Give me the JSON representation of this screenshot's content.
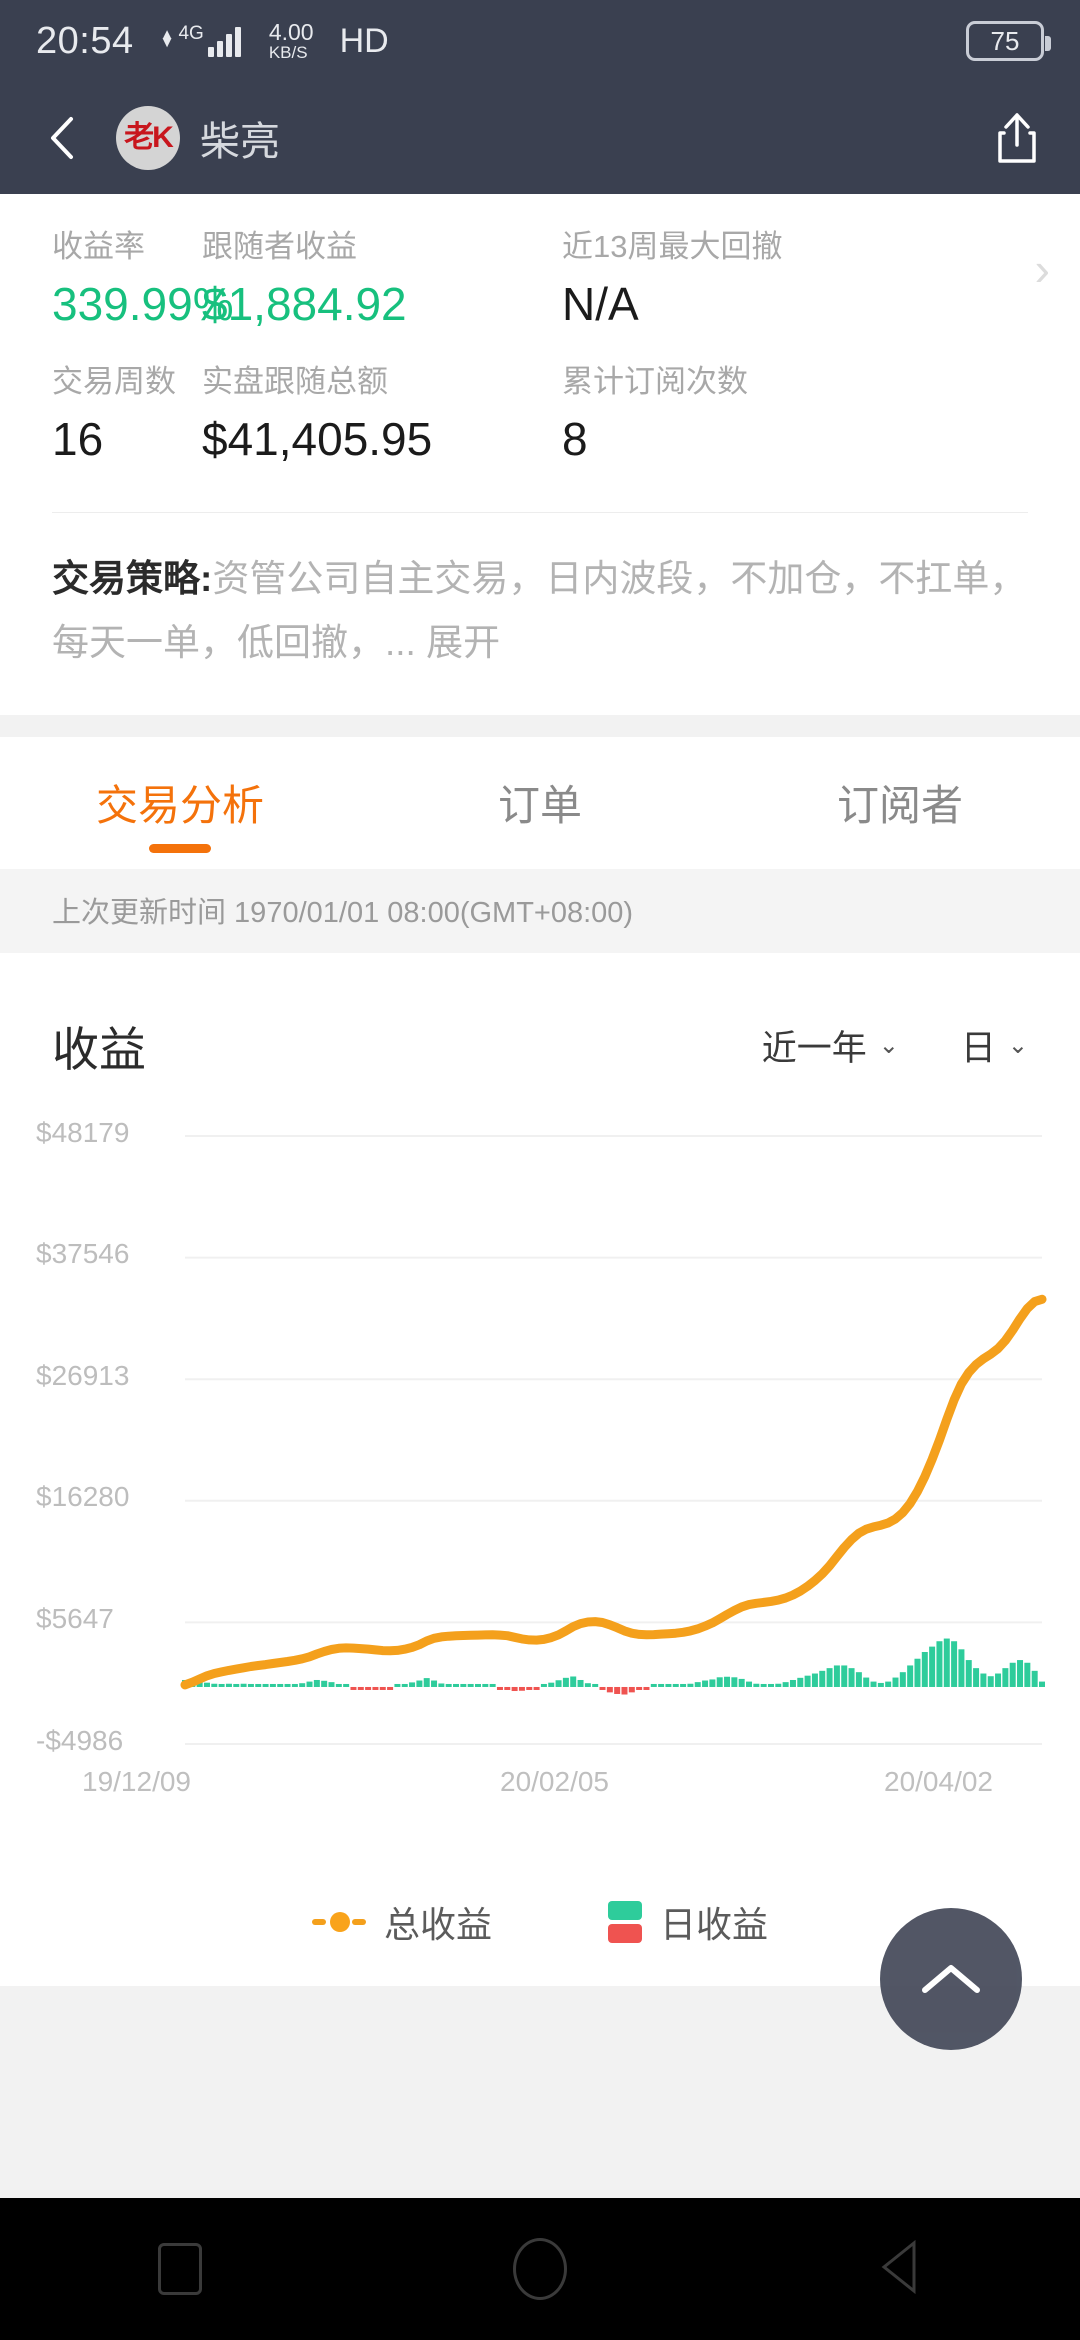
{
  "status_bar": {
    "time": "20:54",
    "network_type": "4G",
    "speed_value": "4.00",
    "speed_unit": "KB/S",
    "hd_label": "HD",
    "battery_level": "75"
  },
  "app_bar": {
    "back_icon": "chevron-left-icon",
    "avatar_text": "老K",
    "account_name": "柴亮",
    "share_icon": "share-icon"
  },
  "stats": {
    "chevron": "›",
    "row1": [
      {
        "label": "收益率",
        "value": "339.99%",
        "color": "green"
      },
      {
        "label": "跟随者收益",
        "value": "$1,884.92",
        "color": "green"
      },
      {
        "label": "近13周最大回撤",
        "value": "N/A",
        "color": "dark"
      }
    ],
    "row2": [
      {
        "label": "交易周数",
        "value": "16",
        "color": "dark"
      },
      {
        "label": "实盘跟随总额",
        "value": "$41,405.95",
        "color": "dark"
      },
      {
        "label": "累计订阅次数",
        "value": "8",
        "color": "dark"
      }
    ]
  },
  "strategy": {
    "title": "交易策略:",
    "body": "资管公司自主交易，日内波段，不加仓，不扛单，每天一单，低回撤，...",
    "expand": "展开"
  },
  "tabs": [
    {
      "label": "交易分析",
      "active": true
    },
    {
      "label": "订单",
      "active": false
    },
    {
      "label": "订阅者",
      "active": false
    }
  ],
  "updated": "上次更新时间 1970/01/01 08:00(GMT+08:00)",
  "chart_header": {
    "title": "收益",
    "range_select": "近一年",
    "period_select": "日",
    "caret": "⌄"
  },
  "legend": [
    {
      "label": "总收益",
      "marker": "line-dot",
      "color": "#f4a01c"
    },
    {
      "label": "日收益",
      "marker": "bars",
      "up_color": "#2ecc9b",
      "down_color": "#ef5350"
    }
  ],
  "fab": {
    "icon": "chevron-up-icon"
  },
  "nav_bar": [
    {
      "icon": "recents-square-icon"
    },
    {
      "icon": "home-circle-icon"
    },
    {
      "icon": "back-triangle-icon"
    }
  ],
  "chart_data": {
    "type": "line",
    "title": "收益",
    "xlabel": "",
    "ylabel": "",
    "grid": true,
    "legend_position": "bottom",
    "ylim": [
      -4986,
      48179
    ],
    "ytick_labels": [
      "$48179",
      "$37546",
      "$26913",
      "$16280",
      "$5647",
      "-$4986"
    ],
    "yticks": [
      48179,
      37546,
      26913,
      16280,
      5647,
      -4986
    ],
    "xtick_labels": [
      "19/12/09",
      "20/02/05",
      "20/04/02"
    ],
    "xticks": [
      0,
      58,
      115
    ],
    "series": [
      {
        "name": "总收益",
        "type": "line",
        "color": "#f4a01c",
        "values": [
          180,
          420,
          700,
          980,
          1180,
          1320,
          1450,
          1560,
          1680,
          1790,
          1880,
          1960,
          2050,
          2140,
          2230,
          2330,
          2460,
          2640,
          2880,
          3100,
          3280,
          3380,
          3420,
          3400,
          3360,
          3310,
          3240,
          3180,
          3160,
          3200,
          3300,
          3460,
          3700,
          4020,
          4260,
          4380,
          4440,
          4480,
          4500,
          4520,
          4540,
          4550,
          4560,
          4540,
          4480,
          4340,
          4200,
          4120,
          4100,
          4160,
          4320,
          4560,
          4900,
          5280,
          5540,
          5680,
          5720,
          5640,
          5440,
          5180,
          4900,
          4700,
          4600,
          4560,
          4580,
          4620,
          4660,
          4700,
          4780,
          4900,
          5080,
          5320,
          5600,
          5960,
          6340,
          6700,
          7000,
          7200,
          7320,
          7400,
          7480,
          7600,
          7780,
          8040,
          8380,
          8800,
          9300,
          9900,
          10600,
          11400,
          12200,
          12900,
          13450,
          13800,
          14000,
          14150,
          14350,
          14700,
          15250,
          16050,
          17100,
          18400,
          19900,
          21600,
          23400,
          25100,
          26500,
          27500,
          28200,
          28700,
          29100,
          29600,
          30300,
          31200,
          32200,
          33100,
          33700,
          33900
        ]
      },
      {
        "name": "日收益",
        "type": "bar",
        "up_color": "#2ecc9b",
        "down_color": "#ef5350",
        "values": [
          260,
          300,
          240,
          160,
          120,
          110,
          120,
          110,
          120,
          110,
          90,
          80,
          90,
          90,
          90,
          110,
          140,
          200,
          260,
          230,
          180,
          110,
          40,
          -30,
          -40,
          -50,
          -70,
          -60,
          -20,
          40,
          100,
          170,
          240,
          330,
          240,
          130,
          60,
          40,
          20,
          20,
          20,
          10,
          10,
          -20,
          -60,
          -150,
          -140,
          -80,
          -20,
          60,
          160,
          250,
          340,
          390,
          260,
          140,
          40,
          -80,
          -200,
          -260,
          -280,
          -200,
          -100,
          -40,
          20,
          40,
          40,
          40,
          80,
          120,
          180,
          240,
          280,
          360,
          380,
          360,
          300,
          200,
          120,
          80,
          80,
          120,
          180,
          260,
          340,
          420,
          500,
          600,
          700,
          800,
          800,
          700,
          550,
          350,
          200,
          150,
          200,
          350,
          550,
          800,
          1050,
          1300,
          1500,
          1700,
          1800,
          1700,
          1400,
          1000,
          700,
          500,
          400,
          500,
          700,
          900,
          1000,
          900,
          600,
          200
        ]
      }
    ]
  }
}
